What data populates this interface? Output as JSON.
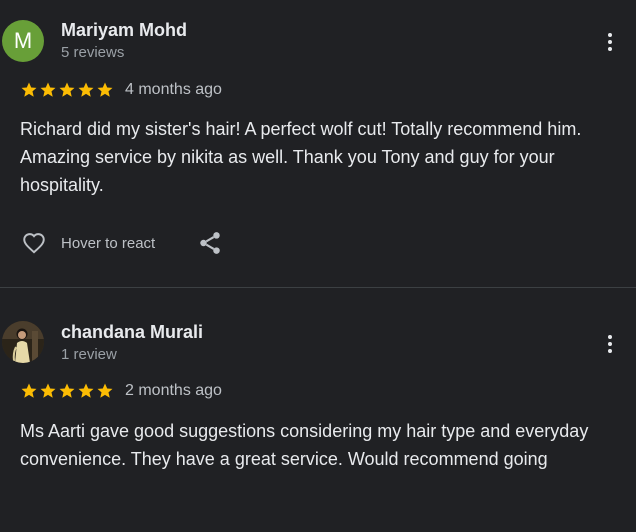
{
  "reviews": [
    {
      "avatar_letter": "M",
      "avatar_color": "#689f38",
      "name": "Mariyam Mohd",
      "review_count": "5 reviews",
      "rating": 5,
      "time": "4 months ago",
      "text": "Richard did my sister's hair! A perfect wolf cut! Totally recommend him. Amazing service by nikita as well. Thank you Tony and guy for your hospitality.",
      "react_label": "Hover to react"
    },
    {
      "avatar_letter": "",
      "avatar_color": "#3b3226",
      "name": "chandana Murali",
      "review_count": "1 review",
      "rating": 5,
      "time": "2 months ago",
      "text": "Ms Aarti gave good suggestions considering my hair type and everyday convenience. They have a great service. Would recommend going"
    }
  ],
  "icons": {
    "star": "star-icon",
    "more": "more-vert-icon",
    "heart": "heart-outline-icon",
    "share": "share-icon"
  },
  "colors": {
    "background": "#202124",
    "star": "#fbbc04",
    "divider": "#3c4043"
  }
}
